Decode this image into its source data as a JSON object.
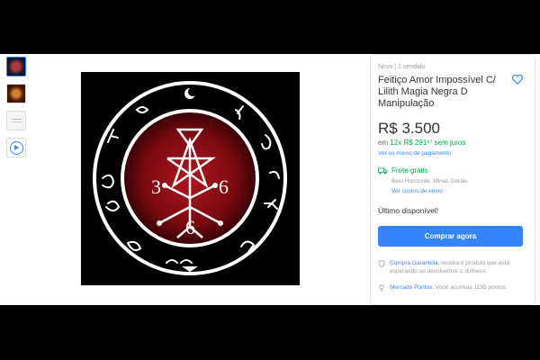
{
  "product": {
    "condition": "Novo  |  1 vendido",
    "title": "Feitiço Amor Impossível C/ Lilith Magia Negra D Manipulação",
    "price": "R$ 3.500",
    "installments_prefix": "em ",
    "installments": "12x R$ 291⁶⁷ sem juros",
    "payment_link": "Ver os meios de pagamento",
    "shipping_title": "Frete grátis",
    "shipping_location": "Belo Horizonte, Minas Gerais",
    "shipping_link": "Ver custos de envio",
    "stock": "Último disponível!",
    "buy_label": "Comprar agora",
    "guarantee_link": "Compra Garantida,",
    "guarantee_text": " receba o produto que está esperando ou devolvemos o dinheiro.",
    "points_link": "Mercado Pontos.",
    "points_text": " Você acumula 1195 pontos."
  },
  "gallery": {
    "thumbnails": [
      "sigil",
      "photo",
      "document",
      "video"
    ],
    "selected_index": 0,
    "main_image": {
      "numbers": [
        "3",
        "6",
        "6"
      ]
    }
  },
  "colors": {
    "accent": "#3483fa",
    "success": "#00a650",
    "sigil_red": "#8b0d14"
  }
}
